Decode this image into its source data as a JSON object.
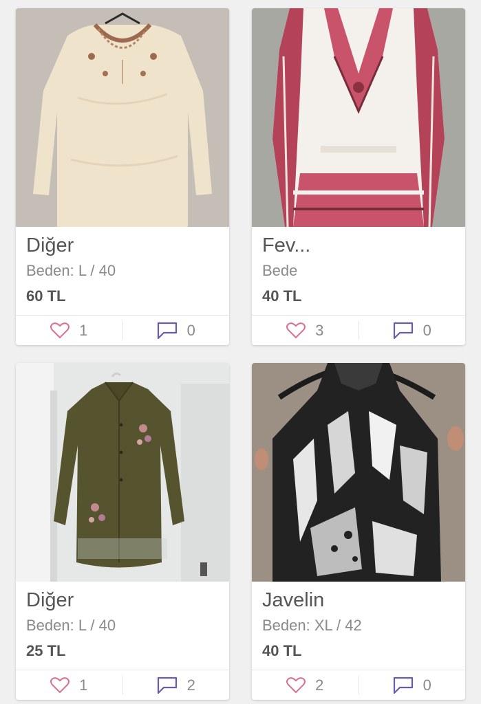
{
  "colors": {
    "heart": "#d9708f",
    "comment": "#6b5aa6",
    "text_dark": "#555555",
    "text_light": "#8a8a8a"
  },
  "products": [
    {
      "brand": "Diğer",
      "size": "Beden: L / 40",
      "price": "60 TL",
      "likes": "1",
      "comments": "0",
      "photo": "cream embroidered blouse"
    },
    {
      "brand": "Fev...",
      "size": "Bede",
      "price": "40 TL",
      "likes": "3",
      "comments": "0",
      "photo": "white and red patterned kaftan"
    },
    {
      "brand": "Diğer",
      "size": "Beden: L / 40",
      "price": "25 TL",
      "likes": "1",
      "comments": "2",
      "photo": "olive green embroidered shirt"
    },
    {
      "brand": "Javelin",
      "size": "Beden: XL / 42",
      "price": "40 TL",
      "likes": "2",
      "comments": "0",
      "photo": "black and white halter top"
    }
  ]
}
